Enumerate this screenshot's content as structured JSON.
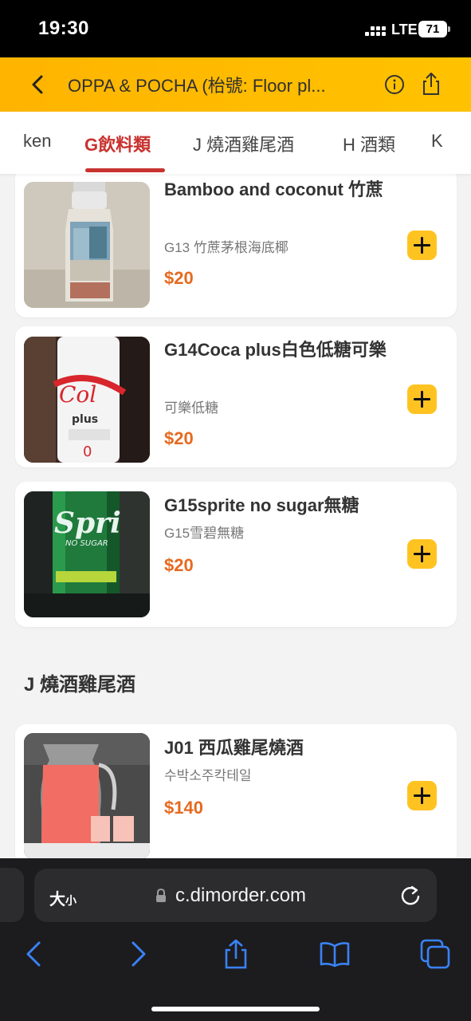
{
  "status_bar": {
    "time": "19:30",
    "network": "LTE",
    "battery": "71"
  },
  "header": {
    "title": "OPPA & POCHA (枱號: Floor pl..."
  },
  "tabs": [
    {
      "label": "ken",
      "active": false
    },
    {
      "label": "G飲料類",
      "active": true
    },
    {
      "label": "J 燒酒雞尾酒",
      "active": false
    },
    {
      "label": "H 酒類",
      "active": false
    },
    {
      "label": "K",
      "active": false
    }
  ],
  "items": [
    {
      "name": "Bamboo and coconut 竹蔗",
      "desc": "G13 竹蔗茅根海底椰",
      "price": "$20"
    },
    {
      "name": "G14Coca plus白色低糖可樂",
      "desc": "可樂低糖",
      "price": "$20"
    },
    {
      "name": "G15sprite no sugar無糖",
      "desc": "G15雪碧無糖",
      "price": "$20"
    },
    {
      "name": "J01 西瓜雞尾燒酒",
      "desc": "수박소주칵테일",
      "price": "$140"
    }
  ],
  "section": {
    "title": "J 燒酒雞尾酒"
  },
  "browser": {
    "text_size_big": "大",
    "text_size_small": "小",
    "url": "c.dimorder.com"
  },
  "colors": {
    "header": "#ffb400",
    "active_tab": "#c8332f",
    "price": "#e66a1f",
    "add_button": "#ffc321"
  }
}
